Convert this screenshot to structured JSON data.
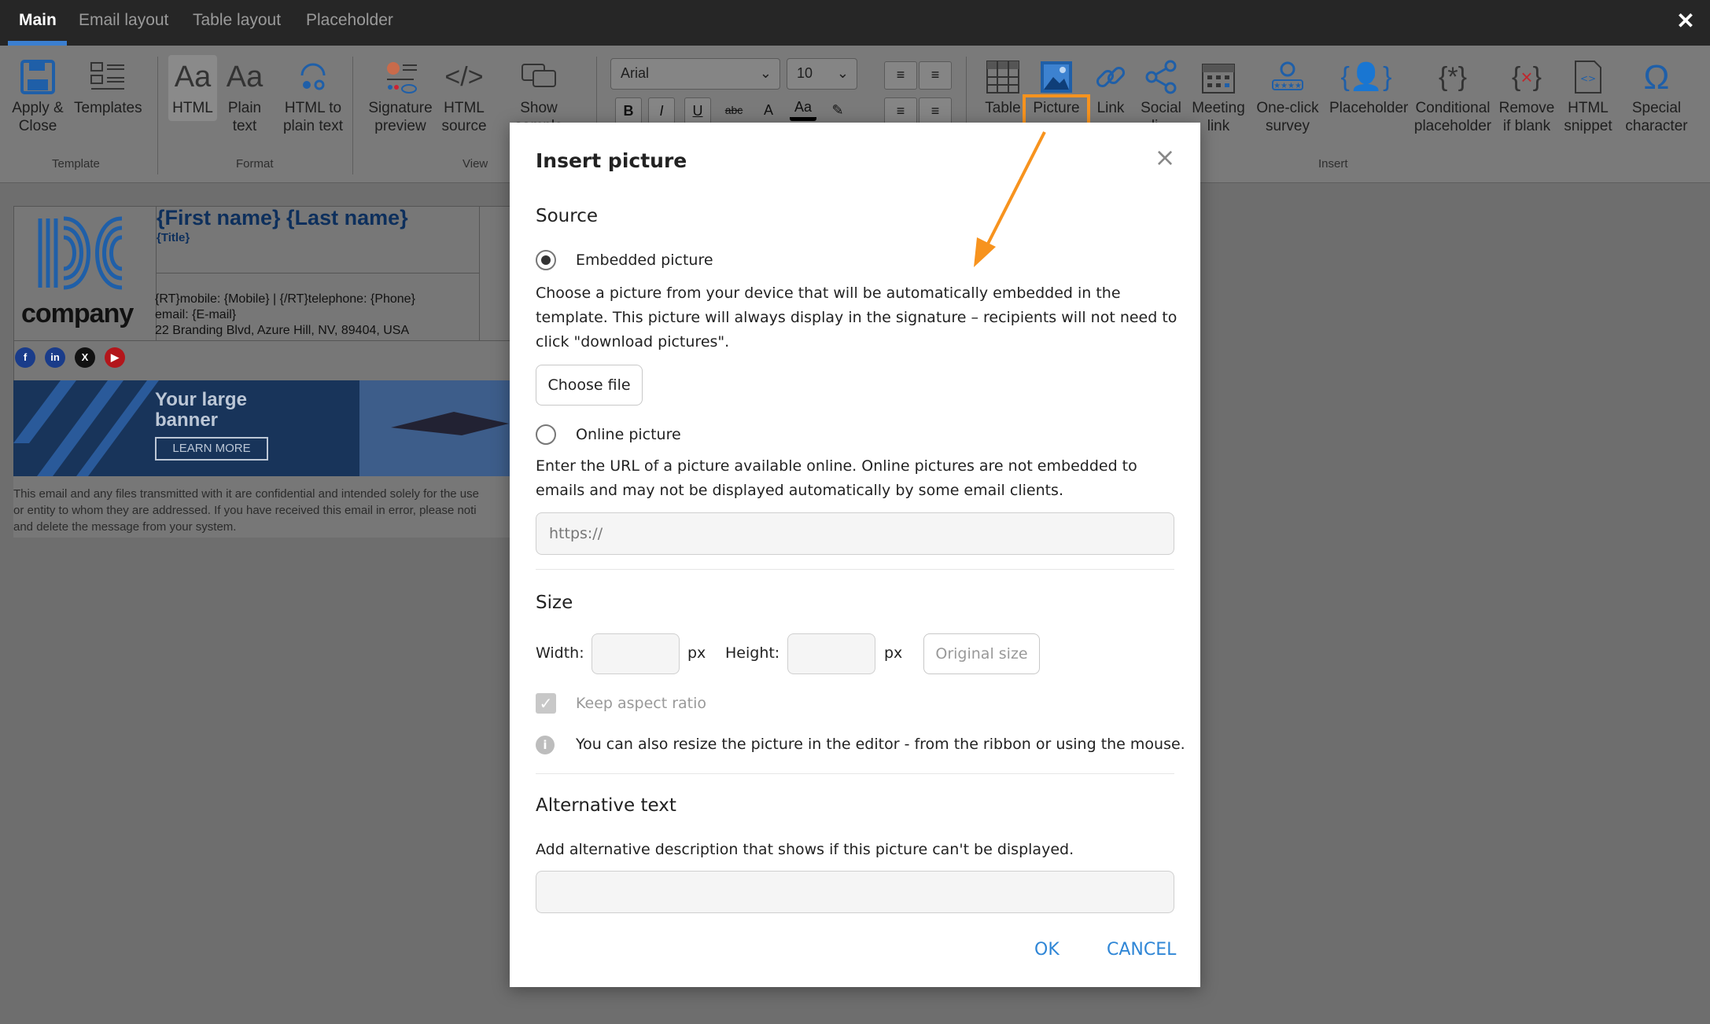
{
  "tabs": [
    "Main",
    "Email layout",
    "Table layout",
    "Placeholder"
  ],
  "ribbon": {
    "template_group": "Template",
    "format_group": "Format",
    "view_group": "View",
    "insert_group": "Insert",
    "apply_close": [
      "Apply &",
      "Close"
    ],
    "templates": "Templates",
    "html": "HTML",
    "plain_text": [
      "Plain",
      "text"
    ],
    "html_to_plain": [
      "HTML to",
      "plain text"
    ],
    "signature_preview": [
      "Signature",
      "preview"
    ],
    "html_source": [
      "HTML",
      "source"
    ],
    "show_sample": [
      "Show sample",
      "e..il th..d"
    ],
    "font_family": "Arial",
    "font_size": "10",
    "bold": "B",
    "italic": "I",
    "underline": "U",
    "strike": "abc",
    "font_color": "Aa",
    "table": "Table",
    "picture": "Picture",
    "link": "Link",
    "social": [
      "Social",
      "li..."
    ],
    "meeting_link": [
      "Meeting",
      "link"
    ],
    "one_click_survey": [
      "One-click",
      "survey"
    ],
    "placeholder": "Placeholder",
    "conditional_placeholder": [
      "Conditional",
      "placeholder"
    ],
    "remove_if_blank": [
      "Remove",
      "if blank"
    ],
    "html_snippet": [
      "HTML",
      "snippet"
    ],
    "special_character": [
      "Special",
      "character"
    ]
  },
  "signature": {
    "logo_text": "company",
    "name": "{First name} {Last name}",
    "title": "{Title}",
    "mobile_line": "{RT}mobile: {Mobile}  |  {/RT}telephone: {Phone}",
    "email_line": "email: {E-mail}",
    "address": "22 Branding Blvd, Azure Hill, NV, 89404, USA",
    "social": [
      "f",
      "in",
      "X",
      "▶"
    ],
    "banner_title": "Your large banner",
    "banner_button": "LEARN MORE",
    "disclaimer": [
      "This email and any files transmitted with it are confidential and intended solely for the use",
      "or entity to whom they are addressed. If you have received this email in error, please noti",
      "and delete the message from your system."
    ]
  },
  "dialog": {
    "title": "Insert picture",
    "source_heading": "Source",
    "embedded_label": "Embedded picture",
    "embedded_desc": "Choose a picture from your device that will be automatically embedded in the template. This picture will always display in the signature – recipients will not need to click \"download pictures\".",
    "choose_file": "Choose file",
    "online_label": "Online picture",
    "online_desc": "Enter the URL of a picture available online. Online pictures are not embedded to emails and may not be displayed automatically by some email clients.",
    "url_placeholder": "https://",
    "size_heading": "Size",
    "width_label": "Width:",
    "height_label": "Height:",
    "px": "px",
    "original_size": "Original size",
    "keep_aspect": "Keep aspect ratio",
    "resize_info": "You can also resize the picture in the editor - from the ribbon or using the mouse.",
    "alt_heading": "Alternative text",
    "alt_desc": "Add alternative description that shows if this picture can't be displayed.",
    "ok": "OK",
    "cancel": "CANCEL"
  },
  "colors": {
    "accent": "#2f86d6",
    "highlight": "#f7931e",
    "topbar": "#262626"
  }
}
